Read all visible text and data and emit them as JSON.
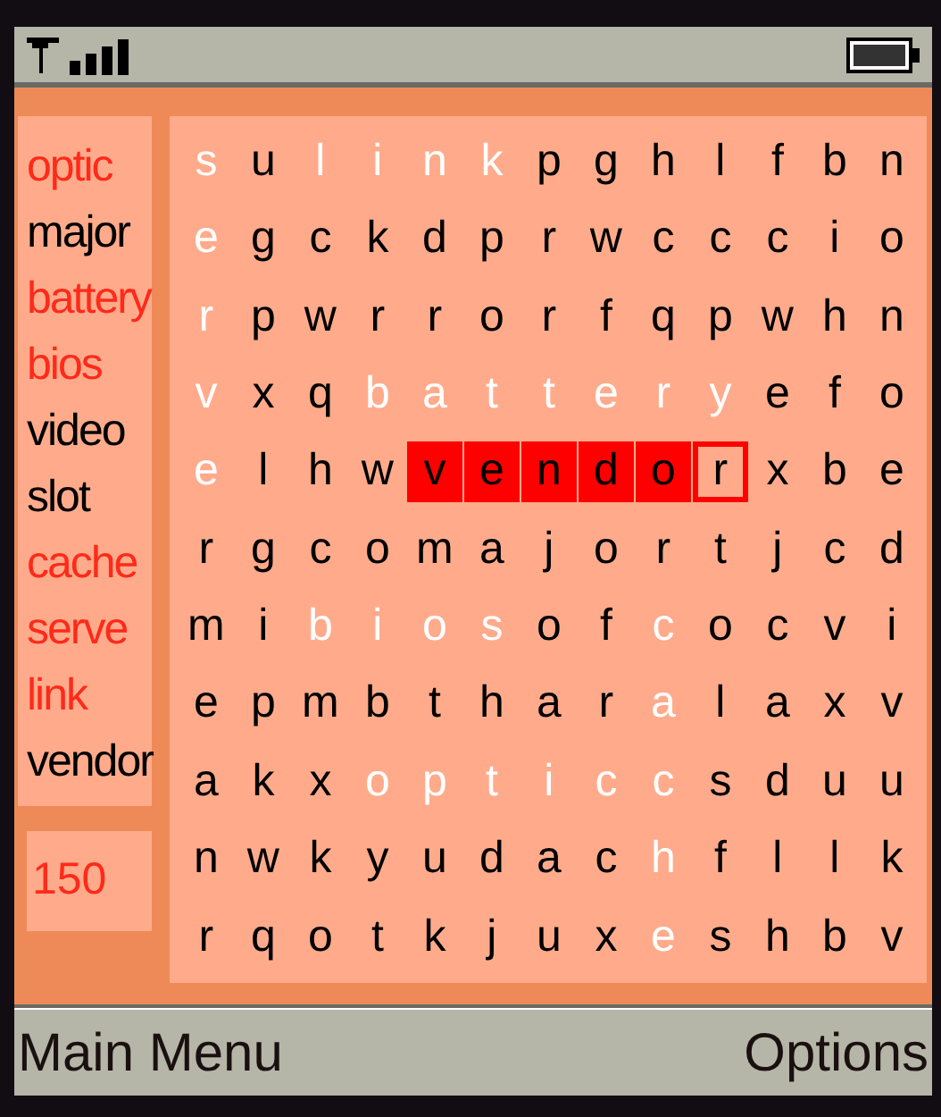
{
  "words": [
    {
      "text": "optic",
      "found": true
    },
    {
      "text": "major",
      "found": false
    },
    {
      "text": "battery",
      "found": true
    },
    {
      "text": "bios",
      "found": true
    },
    {
      "text": "video",
      "found": false
    },
    {
      "text": "slot",
      "found": false
    },
    {
      "text": "cache",
      "found": true
    },
    {
      "text": "serve",
      "found": true
    },
    {
      "text": "link",
      "found": true
    },
    {
      "text": "vendor",
      "found": false
    }
  ],
  "score": "150",
  "grid": [
    [
      {
        "letter": "s",
        "found": true,
        "selected": false,
        "cursor": false
      },
      {
        "letter": "u",
        "found": false,
        "selected": false,
        "cursor": false
      },
      {
        "letter": "l",
        "found": true,
        "selected": false,
        "cursor": false
      },
      {
        "letter": "i",
        "found": true,
        "selected": false,
        "cursor": false
      },
      {
        "letter": "n",
        "found": true,
        "selected": false,
        "cursor": false
      },
      {
        "letter": "k",
        "found": true,
        "selected": false,
        "cursor": false
      },
      {
        "letter": "p",
        "found": false,
        "selected": false,
        "cursor": false
      },
      {
        "letter": "g",
        "found": false,
        "selected": false,
        "cursor": false
      },
      {
        "letter": "h",
        "found": false,
        "selected": false,
        "cursor": false
      },
      {
        "letter": "l",
        "found": false,
        "selected": false,
        "cursor": false
      },
      {
        "letter": "f",
        "found": false,
        "selected": false,
        "cursor": false
      },
      {
        "letter": "b",
        "found": false,
        "selected": false,
        "cursor": false
      },
      {
        "letter": "n",
        "found": false,
        "selected": false,
        "cursor": false
      }
    ],
    [
      {
        "letter": "e",
        "found": true,
        "selected": false,
        "cursor": false
      },
      {
        "letter": "g",
        "found": false,
        "selected": false,
        "cursor": false
      },
      {
        "letter": "c",
        "found": false,
        "selected": false,
        "cursor": false
      },
      {
        "letter": "k",
        "found": false,
        "selected": false,
        "cursor": false
      },
      {
        "letter": "d",
        "found": false,
        "selected": false,
        "cursor": false
      },
      {
        "letter": "p",
        "found": false,
        "selected": false,
        "cursor": false
      },
      {
        "letter": "r",
        "found": false,
        "selected": false,
        "cursor": false
      },
      {
        "letter": "w",
        "found": false,
        "selected": false,
        "cursor": false
      },
      {
        "letter": "c",
        "found": false,
        "selected": false,
        "cursor": false
      },
      {
        "letter": "c",
        "found": false,
        "selected": false,
        "cursor": false
      },
      {
        "letter": "c",
        "found": false,
        "selected": false,
        "cursor": false
      },
      {
        "letter": "i",
        "found": false,
        "selected": false,
        "cursor": false
      },
      {
        "letter": "o",
        "found": false,
        "selected": false,
        "cursor": false
      }
    ],
    [
      {
        "letter": "r",
        "found": true,
        "selected": false,
        "cursor": false
      },
      {
        "letter": "p",
        "found": false,
        "selected": false,
        "cursor": false
      },
      {
        "letter": "w",
        "found": false,
        "selected": false,
        "cursor": false
      },
      {
        "letter": "r",
        "found": false,
        "selected": false,
        "cursor": false
      },
      {
        "letter": "r",
        "found": false,
        "selected": false,
        "cursor": false
      },
      {
        "letter": "o",
        "found": false,
        "selected": false,
        "cursor": false
      },
      {
        "letter": "r",
        "found": false,
        "selected": false,
        "cursor": false
      },
      {
        "letter": "f",
        "found": false,
        "selected": false,
        "cursor": false
      },
      {
        "letter": "q",
        "found": false,
        "selected": false,
        "cursor": false
      },
      {
        "letter": "p",
        "found": false,
        "selected": false,
        "cursor": false
      },
      {
        "letter": "w",
        "found": false,
        "selected": false,
        "cursor": false
      },
      {
        "letter": "h",
        "found": false,
        "selected": false,
        "cursor": false
      },
      {
        "letter": "n",
        "found": false,
        "selected": false,
        "cursor": false
      }
    ],
    [
      {
        "letter": "v",
        "found": true,
        "selected": false,
        "cursor": false
      },
      {
        "letter": "x",
        "found": false,
        "selected": false,
        "cursor": false
      },
      {
        "letter": "q",
        "found": false,
        "selected": false,
        "cursor": false
      },
      {
        "letter": "b",
        "found": true,
        "selected": false,
        "cursor": false
      },
      {
        "letter": "a",
        "found": true,
        "selected": false,
        "cursor": false
      },
      {
        "letter": "t",
        "found": true,
        "selected": false,
        "cursor": false
      },
      {
        "letter": "t",
        "found": true,
        "selected": false,
        "cursor": false
      },
      {
        "letter": "e",
        "found": true,
        "selected": false,
        "cursor": false
      },
      {
        "letter": "r",
        "found": true,
        "selected": false,
        "cursor": false
      },
      {
        "letter": "y",
        "found": true,
        "selected": false,
        "cursor": false
      },
      {
        "letter": "e",
        "found": false,
        "selected": false,
        "cursor": false
      },
      {
        "letter": "f",
        "found": false,
        "selected": false,
        "cursor": false
      },
      {
        "letter": "o",
        "found": false,
        "selected": false,
        "cursor": false
      }
    ],
    [
      {
        "letter": "e",
        "found": true,
        "selected": false,
        "cursor": false
      },
      {
        "letter": "l",
        "found": false,
        "selected": false,
        "cursor": false
      },
      {
        "letter": "h",
        "found": false,
        "selected": false,
        "cursor": false
      },
      {
        "letter": "w",
        "found": false,
        "selected": false,
        "cursor": false
      },
      {
        "letter": "v",
        "found": false,
        "selected": true,
        "cursor": false
      },
      {
        "letter": "e",
        "found": false,
        "selected": true,
        "cursor": false
      },
      {
        "letter": "n",
        "found": false,
        "selected": true,
        "cursor": false
      },
      {
        "letter": "d",
        "found": false,
        "selected": true,
        "cursor": false
      },
      {
        "letter": "o",
        "found": false,
        "selected": true,
        "cursor": false
      },
      {
        "letter": "r",
        "found": false,
        "selected": false,
        "cursor": true
      },
      {
        "letter": "x",
        "found": false,
        "selected": false,
        "cursor": false
      },
      {
        "letter": "b",
        "found": false,
        "selected": false,
        "cursor": false
      },
      {
        "letter": "e",
        "found": false,
        "selected": false,
        "cursor": false
      }
    ],
    [
      {
        "letter": "r",
        "found": false,
        "selected": false,
        "cursor": false
      },
      {
        "letter": "g",
        "found": false,
        "selected": false,
        "cursor": false
      },
      {
        "letter": "c",
        "found": false,
        "selected": false,
        "cursor": false
      },
      {
        "letter": "o",
        "found": false,
        "selected": false,
        "cursor": false
      },
      {
        "letter": "m",
        "found": false,
        "selected": false,
        "cursor": false
      },
      {
        "letter": "a",
        "found": false,
        "selected": false,
        "cursor": false
      },
      {
        "letter": "j",
        "found": false,
        "selected": false,
        "cursor": false
      },
      {
        "letter": "o",
        "found": false,
        "selected": false,
        "cursor": false
      },
      {
        "letter": "r",
        "found": false,
        "selected": false,
        "cursor": false
      },
      {
        "letter": "t",
        "found": false,
        "selected": false,
        "cursor": false
      },
      {
        "letter": "j",
        "found": false,
        "selected": false,
        "cursor": false
      },
      {
        "letter": "c",
        "found": false,
        "selected": false,
        "cursor": false
      },
      {
        "letter": "d",
        "found": false,
        "selected": false,
        "cursor": false
      }
    ],
    [
      {
        "letter": "m",
        "found": false,
        "selected": false,
        "cursor": false
      },
      {
        "letter": "i",
        "found": false,
        "selected": false,
        "cursor": false
      },
      {
        "letter": "b",
        "found": true,
        "selected": false,
        "cursor": false
      },
      {
        "letter": "i",
        "found": true,
        "selected": false,
        "cursor": false
      },
      {
        "letter": "o",
        "found": true,
        "selected": false,
        "cursor": false
      },
      {
        "letter": "s",
        "found": true,
        "selected": false,
        "cursor": false
      },
      {
        "letter": "o",
        "found": false,
        "selected": false,
        "cursor": false
      },
      {
        "letter": "f",
        "found": false,
        "selected": false,
        "cursor": false
      },
      {
        "letter": "c",
        "found": true,
        "selected": false,
        "cursor": false
      },
      {
        "letter": "o",
        "found": false,
        "selected": false,
        "cursor": false
      },
      {
        "letter": "c",
        "found": false,
        "selected": false,
        "cursor": false
      },
      {
        "letter": "v",
        "found": false,
        "selected": false,
        "cursor": false
      },
      {
        "letter": "i",
        "found": false,
        "selected": false,
        "cursor": false
      }
    ],
    [
      {
        "letter": "e",
        "found": false,
        "selected": false,
        "cursor": false
      },
      {
        "letter": "p",
        "found": false,
        "selected": false,
        "cursor": false
      },
      {
        "letter": "m",
        "found": false,
        "selected": false,
        "cursor": false
      },
      {
        "letter": "b",
        "found": false,
        "selected": false,
        "cursor": false
      },
      {
        "letter": "t",
        "found": false,
        "selected": false,
        "cursor": false
      },
      {
        "letter": "h",
        "found": false,
        "selected": false,
        "cursor": false
      },
      {
        "letter": "a",
        "found": false,
        "selected": false,
        "cursor": false
      },
      {
        "letter": "r",
        "found": false,
        "selected": false,
        "cursor": false
      },
      {
        "letter": "a",
        "found": true,
        "selected": false,
        "cursor": false
      },
      {
        "letter": "l",
        "found": false,
        "selected": false,
        "cursor": false
      },
      {
        "letter": "a",
        "found": false,
        "selected": false,
        "cursor": false
      },
      {
        "letter": "x",
        "found": false,
        "selected": false,
        "cursor": false
      },
      {
        "letter": "v",
        "found": false,
        "selected": false,
        "cursor": false
      }
    ],
    [
      {
        "letter": "a",
        "found": false,
        "selected": false,
        "cursor": false
      },
      {
        "letter": "k",
        "found": false,
        "selected": false,
        "cursor": false
      },
      {
        "letter": "x",
        "found": false,
        "selected": false,
        "cursor": false
      },
      {
        "letter": "o",
        "found": true,
        "selected": false,
        "cursor": false
      },
      {
        "letter": "p",
        "found": true,
        "selected": false,
        "cursor": false
      },
      {
        "letter": "t",
        "found": true,
        "selected": false,
        "cursor": false
      },
      {
        "letter": "i",
        "found": true,
        "selected": false,
        "cursor": false
      },
      {
        "letter": "c",
        "found": true,
        "selected": false,
        "cursor": false
      },
      {
        "letter": "c",
        "found": true,
        "selected": false,
        "cursor": false
      },
      {
        "letter": "s",
        "found": false,
        "selected": false,
        "cursor": false
      },
      {
        "letter": "d",
        "found": false,
        "selected": false,
        "cursor": false
      },
      {
        "letter": "u",
        "found": false,
        "selected": false,
        "cursor": false
      },
      {
        "letter": "u",
        "found": false,
        "selected": false,
        "cursor": false
      }
    ],
    [
      {
        "letter": "n",
        "found": false,
        "selected": false,
        "cursor": false
      },
      {
        "letter": "w",
        "found": false,
        "selected": false,
        "cursor": false
      },
      {
        "letter": "k",
        "found": false,
        "selected": false,
        "cursor": false
      },
      {
        "letter": "y",
        "found": false,
        "selected": false,
        "cursor": false
      },
      {
        "letter": "u",
        "found": false,
        "selected": false,
        "cursor": false
      },
      {
        "letter": "d",
        "found": false,
        "selected": false,
        "cursor": false
      },
      {
        "letter": "a",
        "found": false,
        "selected": false,
        "cursor": false
      },
      {
        "letter": "c",
        "found": false,
        "selected": false,
        "cursor": false
      },
      {
        "letter": "h",
        "found": true,
        "selected": false,
        "cursor": false
      },
      {
        "letter": "f",
        "found": false,
        "selected": false,
        "cursor": false
      },
      {
        "letter": "l",
        "found": false,
        "selected": false,
        "cursor": false
      },
      {
        "letter": "l",
        "found": false,
        "selected": false,
        "cursor": false
      },
      {
        "letter": "k",
        "found": false,
        "selected": false,
        "cursor": false
      }
    ],
    [
      {
        "letter": "r",
        "found": false,
        "selected": false,
        "cursor": false
      },
      {
        "letter": "q",
        "found": false,
        "selected": false,
        "cursor": false
      },
      {
        "letter": "o",
        "found": false,
        "selected": false,
        "cursor": false
      },
      {
        "letter": "t",
        "found": false,
        "selected": false,
        "cursor": false
      },
      {
        "letter": "k",
        "found": false,
        "selected": false,
        "cursor": false
      },
      {
        "letter": "j",
        "found": false,
        "selected": false,
        "cursor": false
      },
      {
        "letter": "u",
        "found": false,
        "selected": false,
        "cursor": false
      },
      {
        "letter": "x",
        "found": false,
        "selected": false,
        "cursor": false
      },
      {
        "letter": "e",
        "found": true,
        "selected": false,
        "cursor": false
      },
      {
        "letter": "s",
        "found": false,
        "selected": false,
        "cursor": false
      },
      {
        "letter": "h",
        "found": false,
        "selected": false,
        "cursor": false
      },
      {
        "letter": "b",
        "found": false,
        "selected": false,
        "cursor": false
      },
      {
        "letter": "v",
        "found": false,
        "selected": false,
        "cursor": false
      }
    ]
  ],
  "softkeys": {
    "left": "Main Menu",
    "right": "Options"
  }
}
